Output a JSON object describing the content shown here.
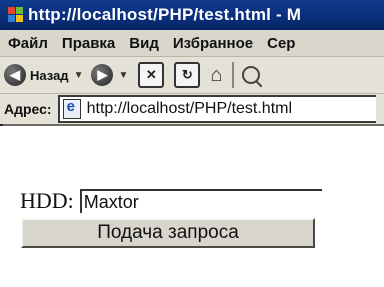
{
  "window": {
    "title": "http://localhost/PHP/test.html - M"
  },
  "menubar": {
    "items": [
      "Файл",
      "Правка",
      "Вид",
      "Избранное",
      "Сер"
    ]
  },
  "toolbar": {
    "back_label": "Назад"
  },
  "addressbar": {
    "label": "Адрес:",
    "url": "http://localhost/PHP/test.html"
  },
  "form": {
    "hdd_label": "HDD:",
    "hdd_value": "Maxtor",
    "submit_label": "Подача запроса"
  }
}
